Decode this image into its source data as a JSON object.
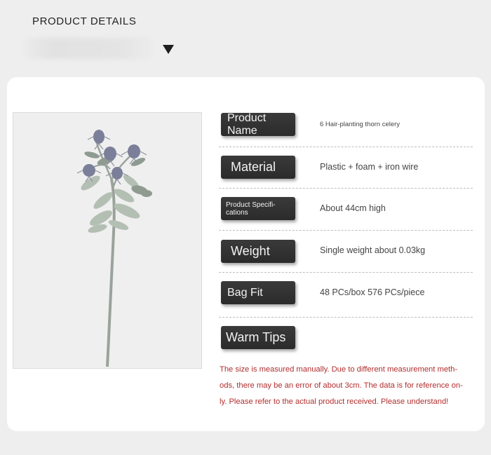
{
  "header": {
    "title": "PRODUCT DETAILS"
  },
  "rows": [
    {
      "label": "Product Name",
      "value": "6 Hair-planting thorn celery"
    },
    {
      "label": "Material",
      "value": "Plastic + foam + iron wire"
    },
    {
      "label": "Product Specifi-\ncations",
      "value": "About 44cm high"
    },
    {
      "label": "Weight",
      "value": "Single weight about 0.03kg"
    },
    {
      "label": "Bag Fit",
      "value": "48 PCs/box 576 PCs/piece"
    }
  ],
  "warm_tips": {
    "label": "Warm Tips",
    "lines": [
      "The size is measured manually. Due to different measurement meth-",
      "ods, there may be an error of about 3cm. The data is for reference on-",
      "ly. Please refer to the actual product received. Please understand!"
    ]
  },
  "colors": {
    "label_bg": "#2f2f2f",
    "tip_text": "#b22d2d",
    "card": "#ffffff",
    "page": "#eeeeee"
  },
  "icons": {
    "dropdown": "triangle-down-icon"
  }
}
